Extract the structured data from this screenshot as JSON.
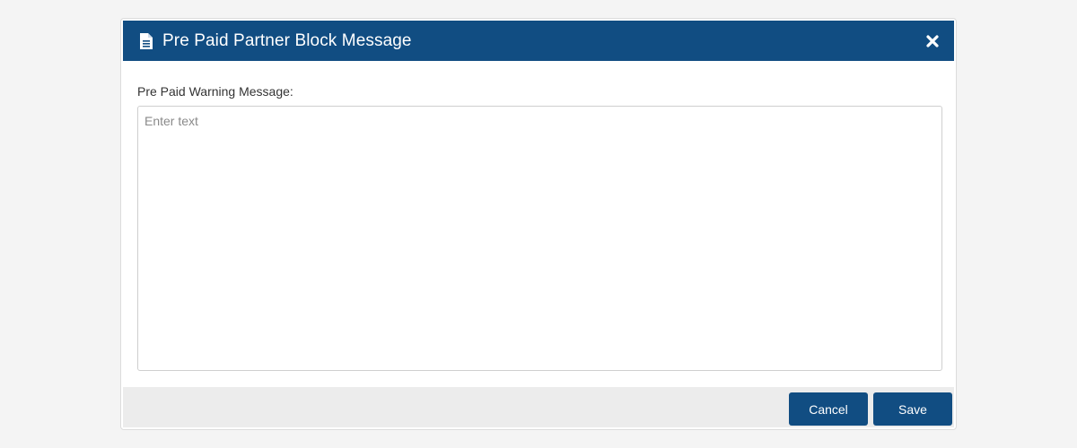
{
  "dialog": {
    "title": "Pre Paid Partner Block Message",
    "title_icon": "document-icon",
    "close_icon": "close-icon"
  },
  "form": {
    "label": "Pre Paid Warning Message:",
    "textarea_value": "",
    "textarea_placeholder": "Enter text"
  },
  "footer": {
    "cancel_label": "Cancel",
    "save_label": "Save"
  },
  "colors": {
    "header_bg": "#114d82",
    "button_bg": "#114d82",
    "footer_bg": "#ececec",
    "page_bg": "#f4f4f4"
  }
}
